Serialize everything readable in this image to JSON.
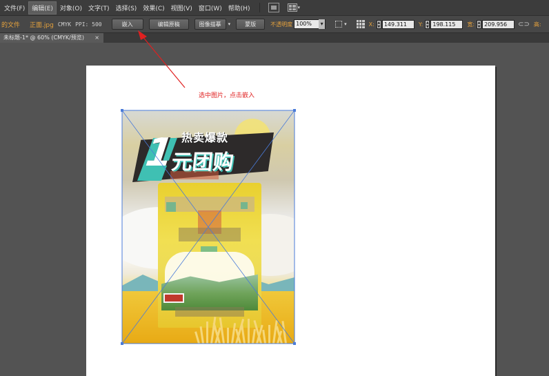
{
  "menubar": {
    "items": [
      {
        "label": "文件(F)"
      },
      {
        "label": "编辑(E)",
        "active": true
      },
      {
        "label": "对象(O)"
      },
      {
        "label": "文字(T)"
      },
      {
        "label": "选择(S)"
      },
      {
        "label": "效果(C)"
      },
      {
        "label": "视图(V)"
      },
      {
        "label": "窗口(W)"
      },
      {
        "label": "帮助(H)"
      }
    ]
  },
  "controlbar": {
    "linked_file_label": "的文件",
    "filename": "正面.jpg",
    "color_mode": "CMYK",
    "ppi": "PPI: 500",
    "embed_button": "嵌入",
    "edit_original_button": "编辑原稿",
    "image_trace_button": "图像描摹",
    "mask_button": "蒙版",
    "opacity_label": "不透明度",
    "opacity_value": "100%",
    "x_label": "X:",
    "x_value": "149.311",
    "y_label": "Y:",
    "y_value": "198.115",
    "w_label": "宽:",
    "w_value": "209.956",
    "h_label": "高:"
  },
  "tabbar": {
    "doc_tab": "未标题-1* @ 60% (CMYK/预览)",
    "close": "×"
  },
  "artwork": {
    "headline_small": "热卖爆款",
    "headline_big": "元团购",
    "big_one": "1"
  },
  "annotation": {
    "text": "选中图片，点击嵌入",
    "color": "#e02020"
  },
  "colors": {
    "accent_orange": "#e6a23c",
    "selection_blue": "#4a7bd9"
  }
}
